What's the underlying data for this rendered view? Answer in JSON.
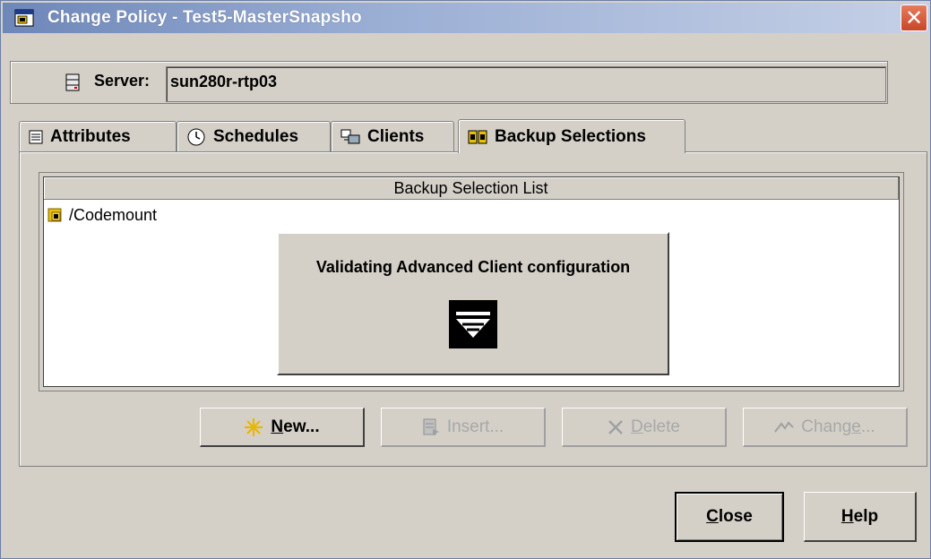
{
  "window": {
    "title": "Change Policy - Test5-MasterSnapsho",
    "close_glyph": "✕"
  },
  "server": {
    "label": "Server:",
    "value": "sun280r-rtp03"
  },
  "tabs": [
    {
      "label": "Attributes",
      "icon": "attributes-icon"
    },
    {
      "label": "Schedules",
      "icon": "schedules-icon"
    },
    {
      "label": "Clients",
      "icon": "clients-icon"
    },
    {
      "label": "Backup Selections",
      "icon": "backup-selections-icon",
      "active": true
    }
  ],
  "selection_list": {
    "header": "Backup Selection List",
    "items": [
      {
        "path": "/Codemount",
        "icon": "folder-icon"
      }
    ]
  },
  "popup": {
    "message": "Validating Advanced Client configuration",
    "icon": "veritas-logo-icon"
  },
  "actions": {
    "new": {
      "mnemonic": "N",
      "rest": "ew...",
      "enabled": true
    },
    "insert": {
      "label": "Insert...",
      "enabled": false
    },
    "delete": {
      "mnemonic": "D",
      "rest": "elete",
      "enabled": false
    },
    "change": {
      "pre": "Chang",
      "mnemonic": "e",
      "post": "...",
      "enabled": false
    }
  },
  "footer": {
    "close": {
      "mnemonic": "C",
      "rest": "lose"
    },
    "help": {
      "mnemonic": "H",
      "rest": "elp"
    }
  },
  "colors": {
    "titlebar_start": "#6e87b9",
    "titlebar_end": "#c5d0e6",
    "window_bg": "#d4d0c8",
    "close_button": "#c9462a",
    "new_icon": "#e8b800"
  }
}
